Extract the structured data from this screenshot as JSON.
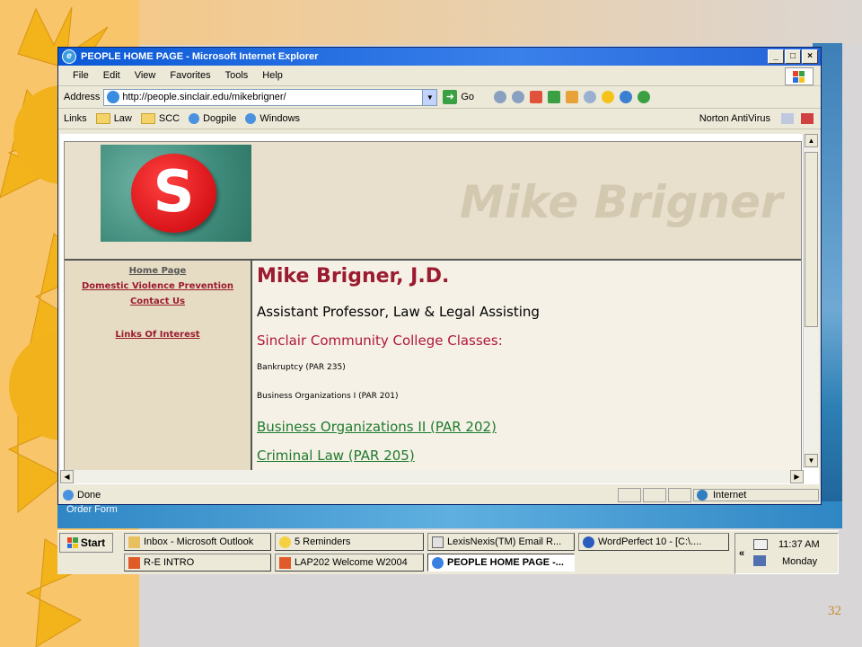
{
  "ie": {
    "title": "PEOPLE HOME PAGE - Microsoft Internet Explorer",
    "menu": [
      "File",
      "Edit",
      "View",
      "Favorites",
      "Tools",
      "Help"
    ],
    "address_label": "Address",
    "address_url": "http://people.sinclair.edu/mikebrigner/",
    "go_label": "Go",
    "links_label": "Links",
    "links": [
      "Law",
      "SCC",
      "Dogpile",
      "Windows"
    ],
    "norton_label": "Norton AntiVirus",
    "status_text": "Done",
    "zone_text": "Internet"
  },
  "page": {
    "banner_name": "Mike Brigner",
    "nav": [
      "Home Page",
      "Domestic Violence Prevention",
      "Contact Us",
      "Links Of Interest"
    ],
    "name": "Mike Brigner, J.D.",
    "position": "Assistant Professor, Law & Legal Assisting",
    "classes_heading": "Sinclair Community College Classes:",
    "class1": "Bankruptcy (PAR 235)",
    "class2": "Business Organizations I (PAR 201)",
    "class3": "Business Organizations II (PAR 202)",
    "class4": "Criminal Law (PAR 205)"
  },
  "slide": {
    "order_form": "Order Form",
    "number": "32"
  },
  "taskbar": {
    "start": "Start",
    "tasks": [
      "Inbox - Microsoft Outlook",
      "5 Reminders",
      "LexisNexis(TM) Email R...",
      "WordPerfect 10 - [C:\\....",
      "R-E INTRO",
      "LAP202 Welcome W2004",
      "PEOPLE HOME PAGE -..."
    ],
    "time": "11:37 AM",
    "day": "Monday"
  }
}
